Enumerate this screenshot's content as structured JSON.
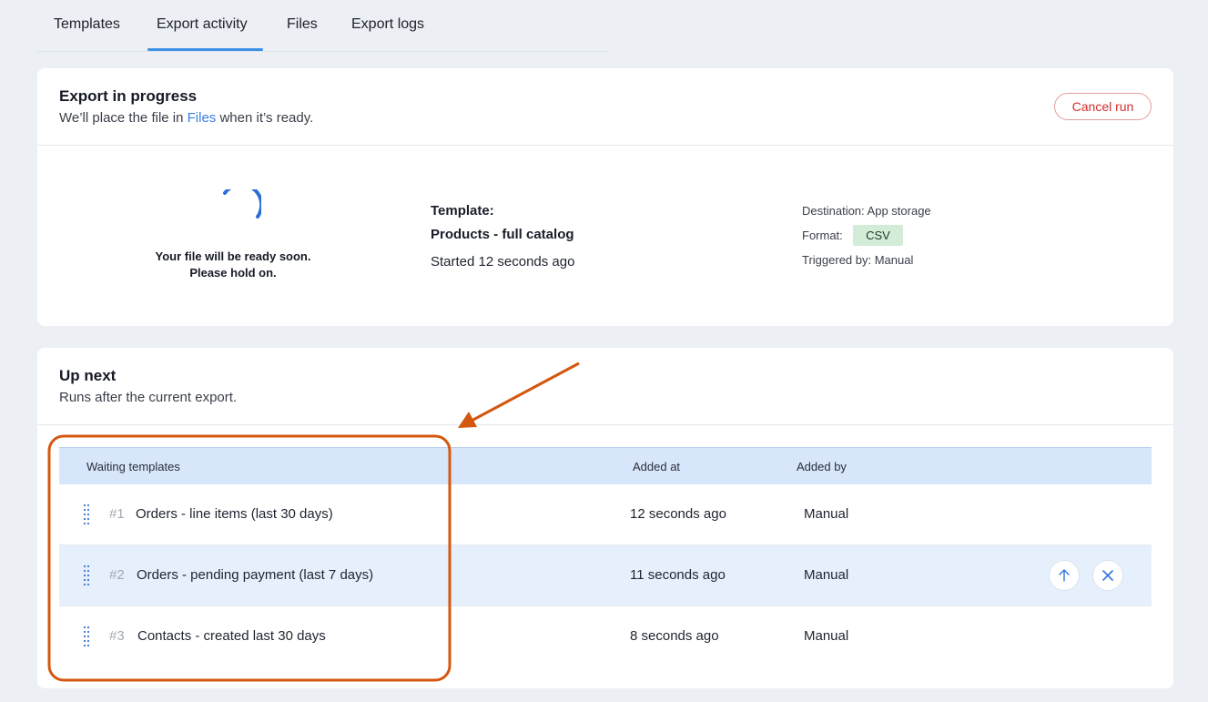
{
  "tabs": [
    {
      "label": "Templates"
    },
    {
      "label": "Export activity"
    },
    {
      "label": "Files"
    },
    {
      "label": "Export logs"
    }
  ],
  "progress": {
    "title": "Export in progress",
    "subtitle_pre": "We’ll place the file in ",
    "subtitle_link": "Files",
    "subtitle_post": " when it’s ready.",
    "cancel_label": "Cancel run",
    "ready_line1": "Your file will be ready soon.",
    "ready_line2": "Please hold on.",
    "template_label": "Template:",
    "template_name": "Products - full catalog",
    "started": "Started 12 seconds ago",
    "destination": "Destination: App storage",
    "format_label": "Format:",
    "format_value": "CSV",
    "triggered": "Triggered by: Manual"
  },
  "upnext": {
    "title": "Up next",
    "subtitle": "Runs after the current export.",
    "columns": {
      "templates": "Waiting templates",
      "added_at": "Added at",
      "added_by": "Added by"
    },
    "rows": [
      {
        "idx": "#1",
        "name": "Orders - line items (last 30 days)",
        "added_at": "12 seconds ago",
        "added_by": "Manual"
      },
      {
        "idx": "#2",
        "name": "Orders - pending payment (last 7 days)",
        "added_at": "11 seconds ago",
        "added_by": "Manual"
      },
      {
        "idx": "#3",
        "name": "Contacts - created last 30 days",
        "added_at": "8 seconds ago",
        "added_by": "Manual"
      }
    ]
  },
  "colors": {
    "accent": "#3c8fe6",
    "annotation": "#d4570f",
    "danger": "#d22d2d"
  },
  "icons": {
    "move_up": "arrow-up-icon",
    "remove": "close-icon",
    "drag": "drag-handle-icon"
  }
}
